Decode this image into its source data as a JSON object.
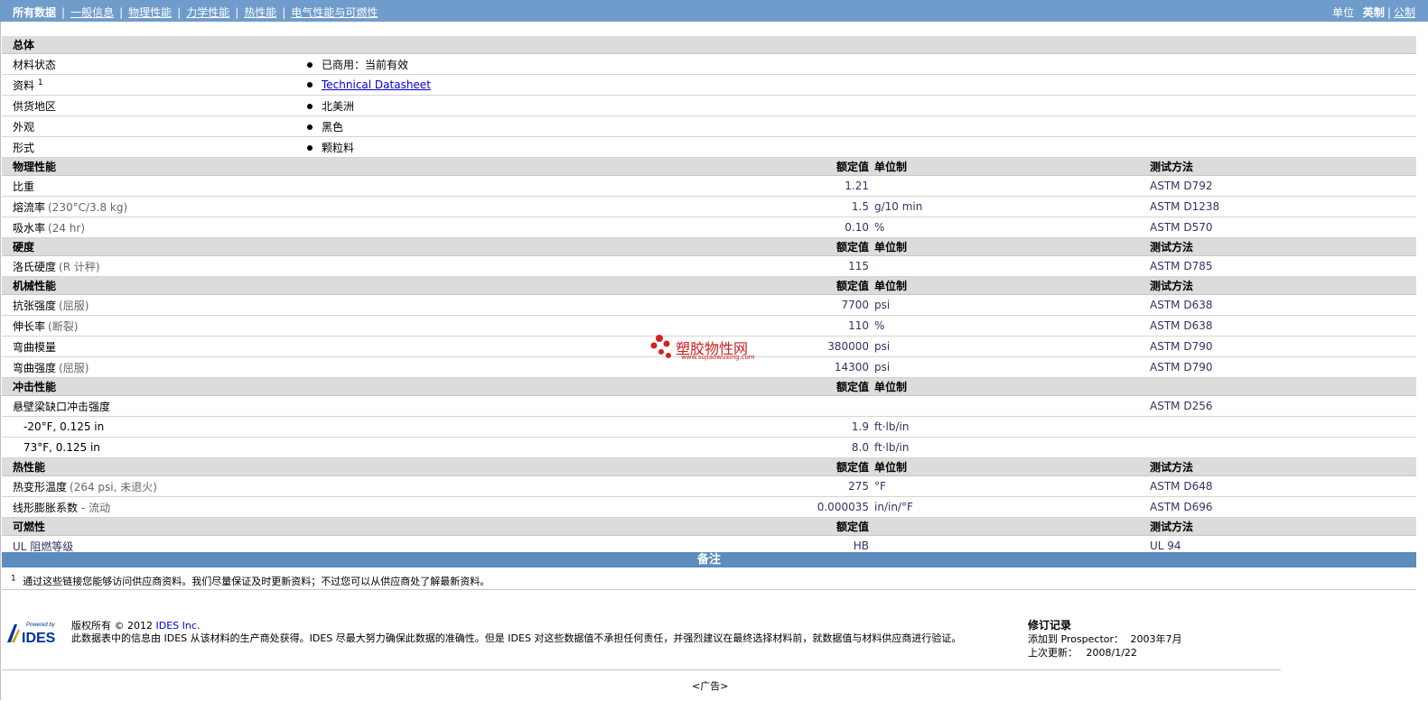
{
  "nav": {
    "tabs": [
      {
        "label": "所有数据",
        "selected": true
      },
      {
        "label": "一般信息"
      },
      {
        "label": "物理性能"
      },
      {
        "label": "力学性能"
      },
      {
        "label": "热性能"
      },
      {
        "label": "电气性能与可燃性"
      }
    ],
    "units_label": "单位",
    "unit_imperial": "英制",
    "unit_metric": "公制"
  },
  "general": {
    "title": "总体",
    "rows": [
      {
        "label": "材料状态",
        "value": "已商用：当前有效"
      },
      {
        "label": "资料",
        "sup": "1",
        "value": "Technical Datasheet",
        "link": true
      },
      {
        "label": "供货地区",
        "value": "北美洲"
      },
      {
        "label": "外观",
        "value": "黑色"
      },
      {
        "label": "形式",
        "value": "颗粒料"
      }
    ]
  },
  "col_headers": {
    "nominal": "额定值",
    "unit": "单位制",
    "method": "测试方法"
  },
  "physical": {
    "title": "物理性能",
    "rows": [
      {
        "label": "比重",
        "value": "1.21",
        "unit": "",
        "method": "ASTM D792"
      },
      {
        "label": "熔流率",
        "note": "(230°C/3.8 kg)",
        "value": "1.5",
        "unit": "g/10 min",
        "method": "ASTM D1238"
      },
      {
        "label": "吸水率",
        "note": "(24 hr)",
        "value": "0.10",
        "unit": "%",
        "method": "ASTM D570"
      }
    ]
  },
  "hardness": {
    "title": "硬度",
    "rows": [
      {
        "label": "洛氏硬度",
        "note": "(R 计秤)",
        "value": "115",
        "unit": "",
        "method": "ASTM D785"
      }
    ]
  },
  "mechanical": {
    "title": "机械性能",
    "rows": [
      {
        "label": "抗张强度",
        "note": "(屈服)",
        "value": "7700",
        "unit": "psi",
        "method": "ASTM D638"
      },
      {
        "label": "伸长率",
        "note": "(断裂)",
        "value": "110",
        "unit": "%",
        "method": "ASTM D638"
      },
      {
        "label": "弯曲模量",
        "value": "380000",
        "unit": "psi",
        "method": "ASTM D790"
      },
      {
        "label": "弯曲强度",
        "note": "(屈服)",
        "value": "14300",
        "unit": "psi",
        "method": "ASTM D790"
      }
    ]
  },
  "impact": {
    "title": "冲击性能",
    "rows": [
      {
        "label": "悬壁梁缺口冲击强度",
        "value": "",
        "unit": "",
        "method": "ASTM D256"
      },
      {
        "label": "-20°F, 0.125 in",
        "value": "1.9",
        "unit": "ft·lb/in",
        "method": "",
        "sub": true
      },
      {
        "label": "73°F, 0.125 in",
        "value": "8.0",
        "unit": "ft·lb/in",
        "method": "",
        "sub": true
      }
    ]
  },
  "thermal": {
    "title": "热性能",
    "rows": [
      {
        "label": "热变形温度",
        "note": "(264 psi, 未退火)",
        "value": "275",
        "unit": "°F",
        "method": "ASTM D648"
      },
      {
        "label": "线形膨胀系数",
        "note": "- 流动",
        "value": "0.000035",
        "unit": "in/in/°F",
        "method": "ASTM D696"
      }
    ]
  },
  "flammability": {
    "title": "可燃性",
    "rows": [
      {
        "label": "UL 阻燃等级",
        "value": "HB",
        "unit": "",
        "method": "UL 94"
      }
    ]
  },
  "remarks": {
    "title": "备注",
    "sup": "1",
    "text": "通过这些链接您能够访问供应商资料。我们尽量保证及时更新资料；不过您可以从供应商处了解最新资料。"
  },
  "footer": {
    "logo_small": "Powered by",
    "logo_text": "IDES",
    "copyright": "版权所有 © 2012",
    "company_link": "IDES Inc.",
    "disclaimer": "此数据表中的信息由 IDES 从该材料的生产商处获得。IDES 尽最大努力确保此数据的准确性。但是 IDES 对这些数据值不承担任何责任，并强烈建议在最终选择材料前，就数据值与材料供应商进行验证。",
    "revision_title": "修订记录",
    "added_label": "添加到 Prospector：",
    "added_value": "2003年7月",
    "updated_label": "上次更新：",
    "updated_value": "2008/1/22",
    "ad": "<广告>"
  },
  "watermark": {
    "text": "塑胶物性网",
    "url": "www.sujiaowuxing.com"
  },
  "colors": {
    "topbar": "#6f9ccb",
    "remarks_bar": "#5b8cbd",
    "section_bg": "#dcdcdc",
    "watermark": "#cc2020"
  }
}
